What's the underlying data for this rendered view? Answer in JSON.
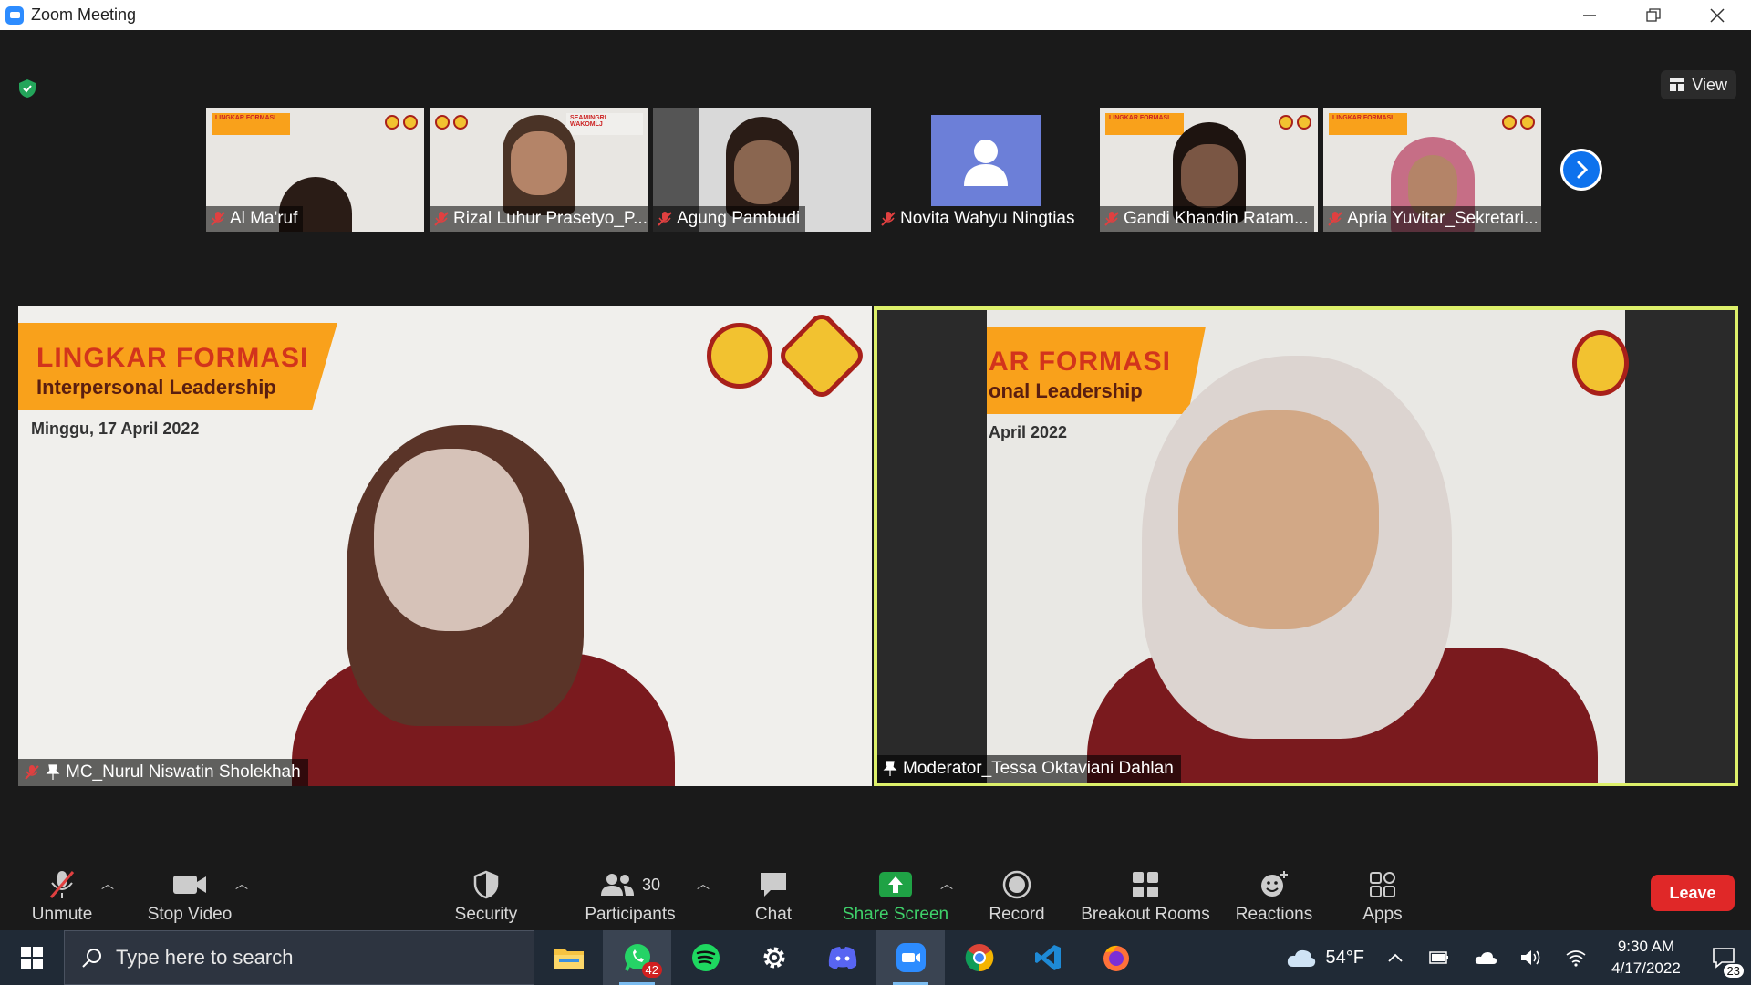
{
  "window": {
    "title": "Zoom Meeting",
    "minimize": "—",
    "restore": "❐",
    "close": "✕"
  },
  "view_button": {
    "label": "View"
  },
  "thumbnails": [
    {
      "name": "Al Ma'ruf",
      "type": "slide"
    },
    {
      "name": "Rizal Luhur Prasetyo_P...",
      "type": "slide"
    },
    {
      "name": "Agung Pambudi",
      "type": "camera"
    },
    {
      "name": "Novita Wahyu Ningtias",
      "type": "avatar"
    },
    {
      "name": "Gandi Khandin Ratam...",
      "type": "slide"
    },
    {
      "name": "Apria Yuvitar_Sekretari...",
      "type": "slide"
    }
  ],
  "main_tiles": {
    "left": {
      "name": "MC_Nurul Niswatin Sholekhah",
      "slide_title": "LINGKAR FORMASI",
      "slide_subtitle": "Interpersonal Leadership",
      "slide_date": "Minggu, 17 April 2022"
    },
    "right": {
      "name": "Moderator_Tessa Oktaviani Dahlan",
      "slide_title": "AR FORMASI",
      "slide_subtitle": "onal Leadership",
      "slide_date": "April 2022",
      "active_speaker_color": "#ddf06a"
    }
  },
  "toolbar": {
    "unmute": "Unmute",
    "stop_video": "Stop Video",
    "security": "Security",
    "participants": "Participants",
    "participants_count": "30",
    "chat": "Chat",
    "share_screen": "Share Screen",
    "record": "Record",
    "breakout_rooms": "Breakout Rooms",
    "reactions": "Reactions",
    "apps": "Apps",
    "leave": "Leave"
  },
  "taskbar": {
    "search_placeholder": "Type here to search",
    "whatsapp_badge": "42",
    "weather": "54°F",
    "time": "9:30 AM",
    "date": "4/17/2022",
    "notifications": "23"
  },
  "colors": {
    "accent_blue": "#0e72ed",
    "leave_red": "#e02828",
    "share_green": "#1fa245",
    "muted_red": "#e04040",
    "slide_orange": "#f9a11b"
  }
}
